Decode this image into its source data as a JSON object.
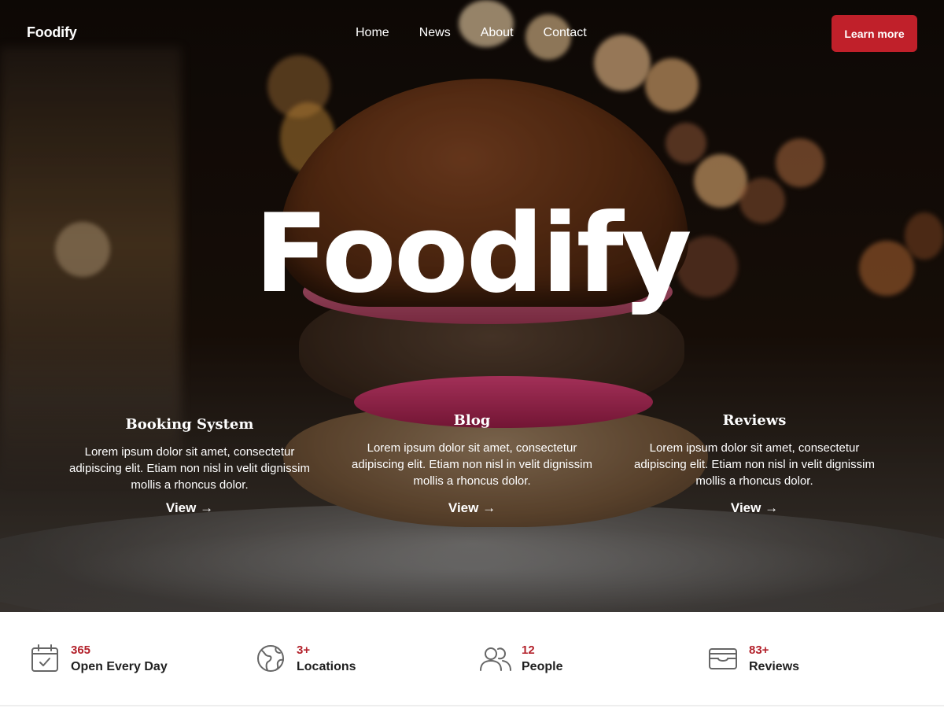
{
  "header": {
    "logo": "Foodify",
    "nav": [
      "Home",
      "News",
      "About",
      "Contact"
    ],
    "cta_label": "Learn more"
  },
  "hero": {
    "title": "Foodify"
  },
  "features": [
    {
      "title": "Booking System",
      "text": "Lorem ipsum dolor sit amet, consectetur adipiscing elit. Etiam non nisl in velit dignissim mollis a rhoncus dolor.",
      "link": "View →"
    },
    {
      "title": "Blog",
      "text": "Lorem ipsum dolor sit amet, consectetur adipiscing elit. Etiam non nisl in velit dignissim mollis a rhoncus dolor.",
      "link": "View →"
    },
    {
      "title": "Reviews",
      "text": "Lorem ipsum dolor sit amet, consectetur adipiscing elit. Etiam non nisl in velit dignissim mollis a rhoncus dolor.",
      "link": "View →"
    }
  ],
  "stats": [
    {
      "icon": "calendar-check-icon",
      "number": "365",
      "label": "Open Every Day"
    },
    {
      "icon": "globe-icon",
      "number": "3+",
      "label": "Locations"
    },
    {
      "icon": "people-icon",
      "number": "12",
      "label": "People"
    },
    {
      "icon": "wallet-icon",
      "number": "83+",
      "label": "Reviews"
    }
  ],
  "colors": {
    "accent": "#c0202a",
    "stat_number": "#b3212b",
    "icon_stroke": "#666666"
  }
}
